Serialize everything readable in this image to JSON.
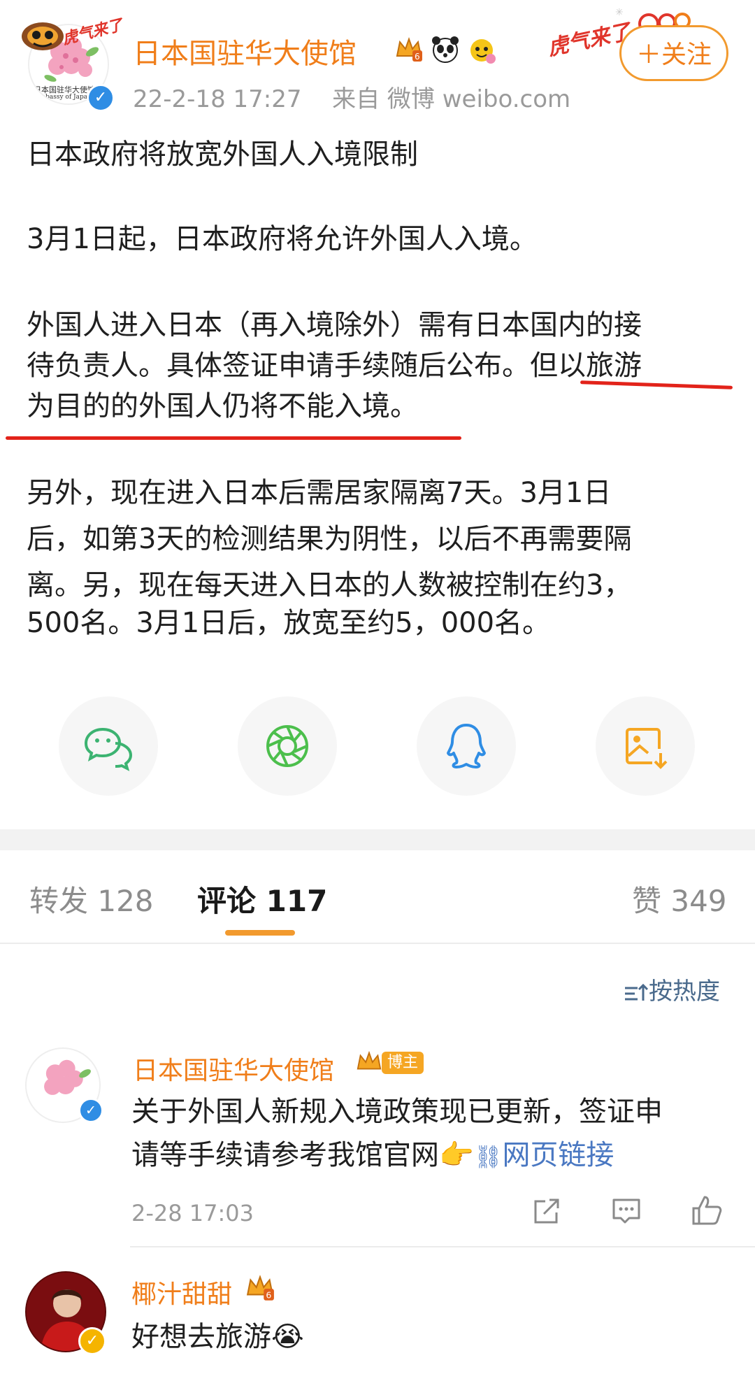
{
  "header": {
    "account_name": "日本国驻华大使馆",
    "timestamp": "22-2-18 17:27",
    "source_label": "来自 微博 weibo.com",
    "follow_label": "＋关注",
    "avatar_caption": "日本国驻华大使馆",
    "avatar_caption_en": "Embassy of Japan",
    "decor_text_left": "虎气来了",
    "decor_text_right": "虎气来了"
  },
  "post": {
    "lines": [
      "日本政府将放宽外国人入境限制",
      "3月1日起，日本政府将允许外国人入境。",
      "外国人进入日本（再入境除外）需有日本国内的接",
      "待负责人。具体签证申请手续随后公布。但以旅游",
      "为目的的外国人仍将不能入境。",
      "另外，现在进入日本后需居家隔离7天。3月1日",
      "后，如第3天的检测结果为阴性，以后不再需要隔",
      "离。另，现在每天进入日本的人数被控制在约3，",
      "500名。3月1日后，放宽至约5，000名。"
    ]
  },
  "share": {
    "icons": [
      "wechat-icon",
      "moments-icon",
      "qq-icon",
      "save-image-icon"
    ],
    "colors": {
      "wechat": "#3cb371",
      "moments": "#4cbf4c",
      "qq": "#2f8de4",
      "save": "#f5a623"
    }
  },
  "tabs": {
    "repost": "转发 128",
    "comments": "评论 117",
    "likes": "赞 349"
  },
  "sort_label": "按热度",
  "comments": [
    {
      "name": "日本国驻华大使馆",
      "badge": "博主",
      "text_line1": "关于外国人新规入境政策现已更新，签证申",
      "text_line2": "请等手续请参考我馆官网",
      "link_text": "网页链接",
      "time": "2-28 17:03"
    },
    {
      "name": "椰汁甜甜",
      "text": "好想去旅游"
    }
  ],
  "colors": {
    "accent": "#f07e1a",
    "underline_red": "#e2231a",
    "verified_blue": "#2f8de4"
  }
}
